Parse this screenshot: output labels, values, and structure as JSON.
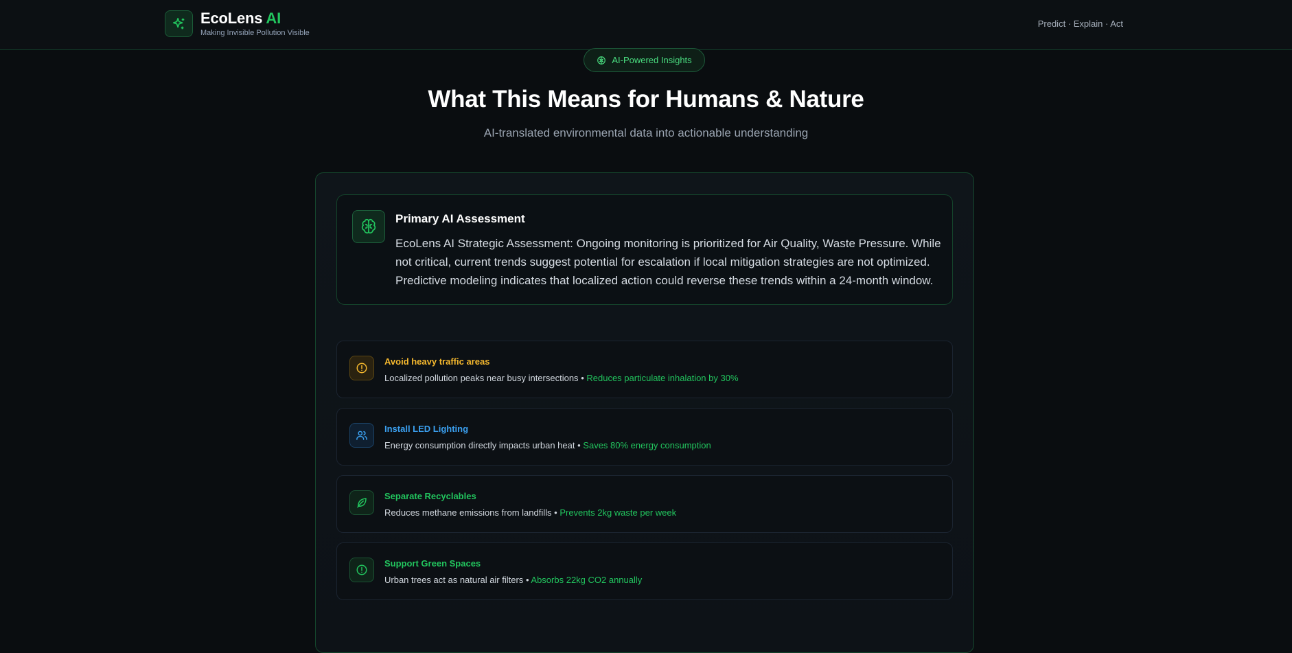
{
  "header": {
    "brand_name": "EcoLens",
    "brand_accent": "AI",
    "tagline": "Making Invisible Pollution Visible",
    "nav_tagline": "Predict · Explain · Act"
  },
  "badge": {
    "label": "AI-Powered Insights"
  },
  "hero": {
    "title": "What This Means for Humans & Nature",
    "subtitle": "AI-translated environmental data into actionable understanding"
  },
  "assessment": {
    "title": "Primary AI Assessment",
    "body": "EcoLens AI Strategic Assessment: Ongoing monitoring is prioritized for Air Quality, Waste Pressure. While not critical, current trends suggest potential for escalation if local mitigation strategies are not optimized. Predictive modeling indicates that localized action could reverse these trends within a 24-month window."
  },
  "actions": [
    {
      "icon": "alert-circle-icon",
      "title": "Avoid heavy traffic areas",
      "description": "Localized pollution peaks near busy intersections",
      "separator": "•",
      "impact": "Reduces particulate inhalation by 30%",
      "color": "#f5b82e"
    },
    {
      "icon": "users-icon",
      "title": "Install LED Lighting",
      "description": "Energy consumption directly impacts urban heat",
      "separator": "•",
      "impact": "Saves 80% energy consumption",
      "color": "#3ba0f0"
    },
    {
      "icon": "leaf-icon",
      "title": "Separate Recyclables",
      "description": "Reduces methane emissions from landfills",
      "separator": "•",
      "impact": "Prevents 2kg waste per week",
      "color": "#22c55e"
    },
    {
      "icon": "alert-circle-icon",
      "title": "Support Green Spaces",
      "description": "Urban trees act as natural air filters",
      "separator": "•",
      "impact": "Absorbs 22kg CO2 annually",
      "color": "#22c55e"
    }
  ],
  "colors": {
    "accent": "#22c55e",
    "background": "#0a0d10",
    "warning": "#f5b82e",
    "info": "#3ba0f0"
  }
}
